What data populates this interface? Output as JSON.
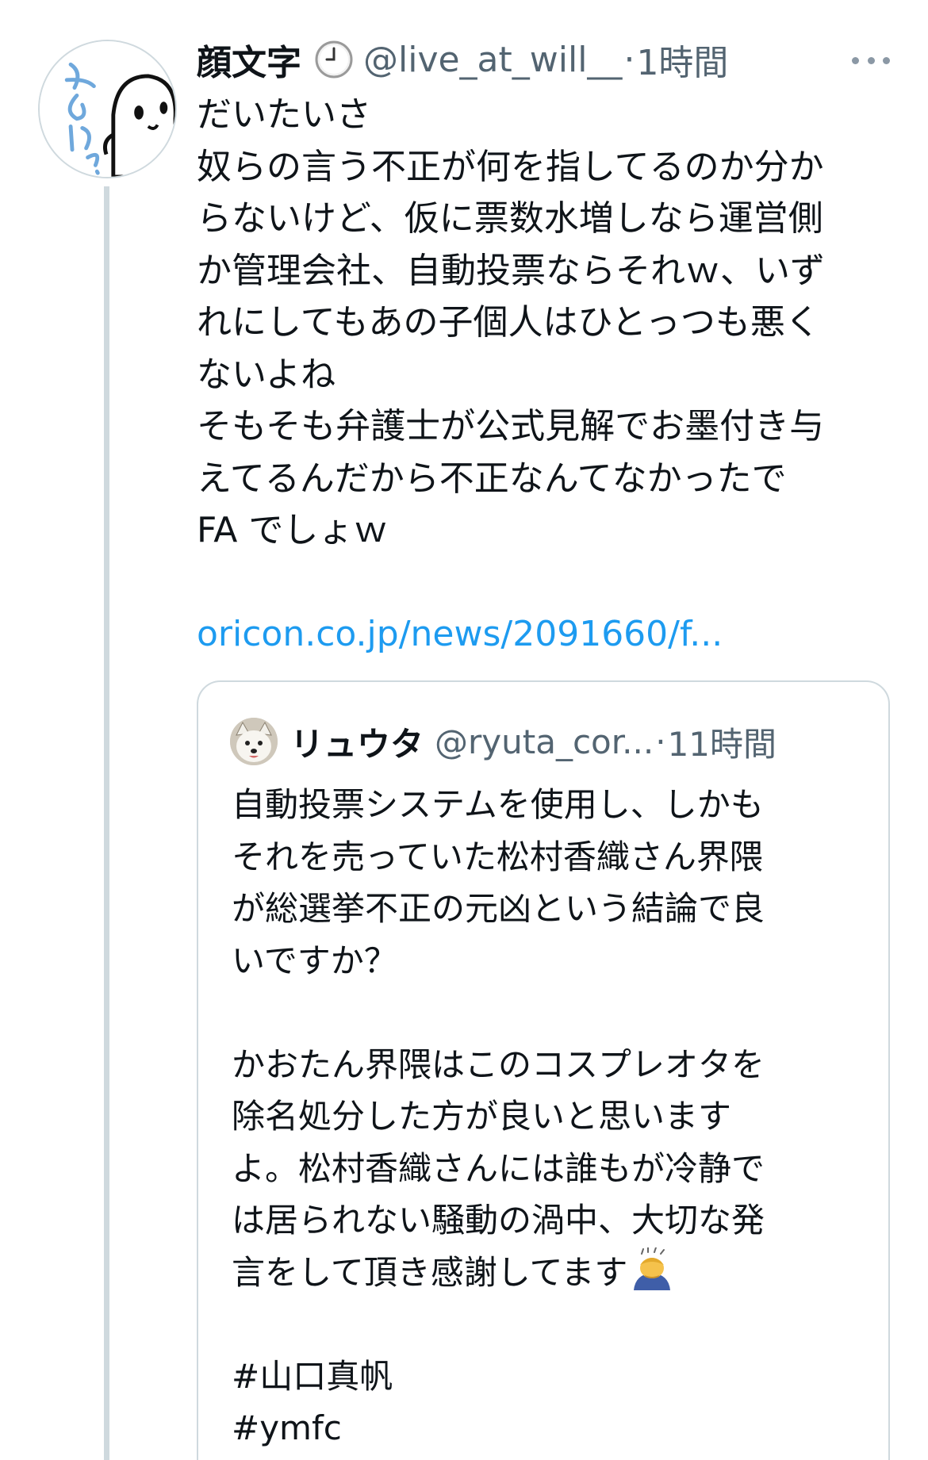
{
  "tweet": {
    "display_name": "顔文字",
    "handle": "@live_at_will__",
    "separator": "·",
    "time": "1時間",
    "body_lines": [
      "だいたいさ",
      "奴らの言う不正が何を指してるのか分か",
      "らないけど、仮に票数水増しなら運営側",
      "か管理会社、自動投票ならそれｗ、いず",
      "れにしてもあの子個人はひとっつも悪く",
      "ないよね",
      "そもそも弁護士が公式見解でお墨付き与",
      "えてるんだから不正なんてなかったで",
      "FA でしょｗ"
    ],
    "link": "oricon.co.jp/news/2091660/f...",
    "icons": {
      "avatar": "avatar-nani-ghost",
      "name_badge": "clock-icon",
      "menu": "more-icon"
    },
    "colors": {
      "link": "#1d9bf0",
      "secondary_text": "#536471",
      "thread_line": "#cfd9de"
    }
  },
  "quote": {
    "display_name": "リュウタ",
    "handle": "@ryuta_cor...",
    "separator": "·",
    "time": "11時間",
    "body_lines": [
      "自動投票システムを使用し、しかも",
      "それを売っていた松村香織さん界隈",
      "が総選挙不正の元凶という結論で良",
      "いですか？",
      "",
      "かおたん界隈はこのコスプレオタを",
      "除名処分した方が良いと思います",
      "よ。松村香織さんには誰もが冷静で",
      "は居られない騒動の渦中、大切な発",
      "言をして頂き感謝してます"
    ],
    "body_emoji": "person-bowing-emoji",
    "hashtags": [
      "#山口真帆",
      "#ymfc"
    ],
    "icons": {
      "avatar": "dog-avatar"
    }
  }
}
